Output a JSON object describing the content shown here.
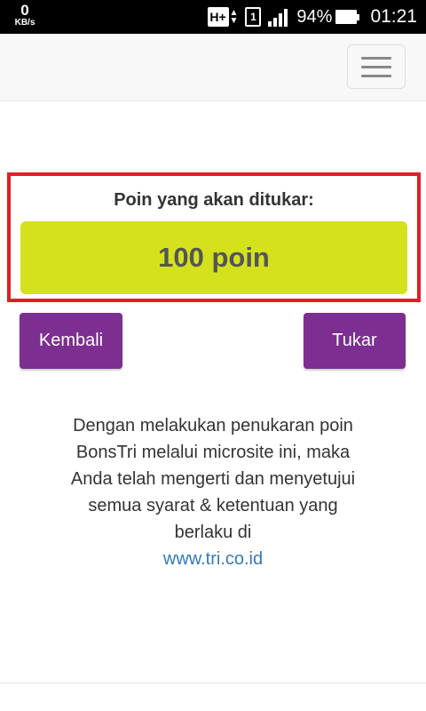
{
  "status_bar": {
    "net_speed_value": "0",
    "net_speed_unit": "KB/s",
    "network_type": "H+",
    "sim_slot": "1",
    "battery_percent": "94%",
    "time": "01:21",
    "icons": [
      "hplus-network-icon",
      "sim-card-icon",
      "signal-strength-icon",
      "battery-icon"
    ]
  },
  "navbar": {
    "menu_icon": "hamburger-menu-icon"
  },
  "exchange": {
    "label": "Poin yang akan ditukar:",
    "points": "100 poin",
    "accent_color": "#d4e21d",
    "highlight_border_color": "#e21e26"
  },
  "buttons": {
    "back_label": "Kembali",
    "exchange_label": "Tukar",
    "color": "#7c2e91"
  },
  "disclaimer": {
    "lines": [
      "Dengan melakukan penukaran poin",
      "BonsTri melalui microsite ini, maka",
      "Anda telah mengerti dan menyetujui",
      "semua syarat & ketentuan yang",
      "berlaku di"
    ],
    "link_text": "www.tri.co.id"
  }
}
